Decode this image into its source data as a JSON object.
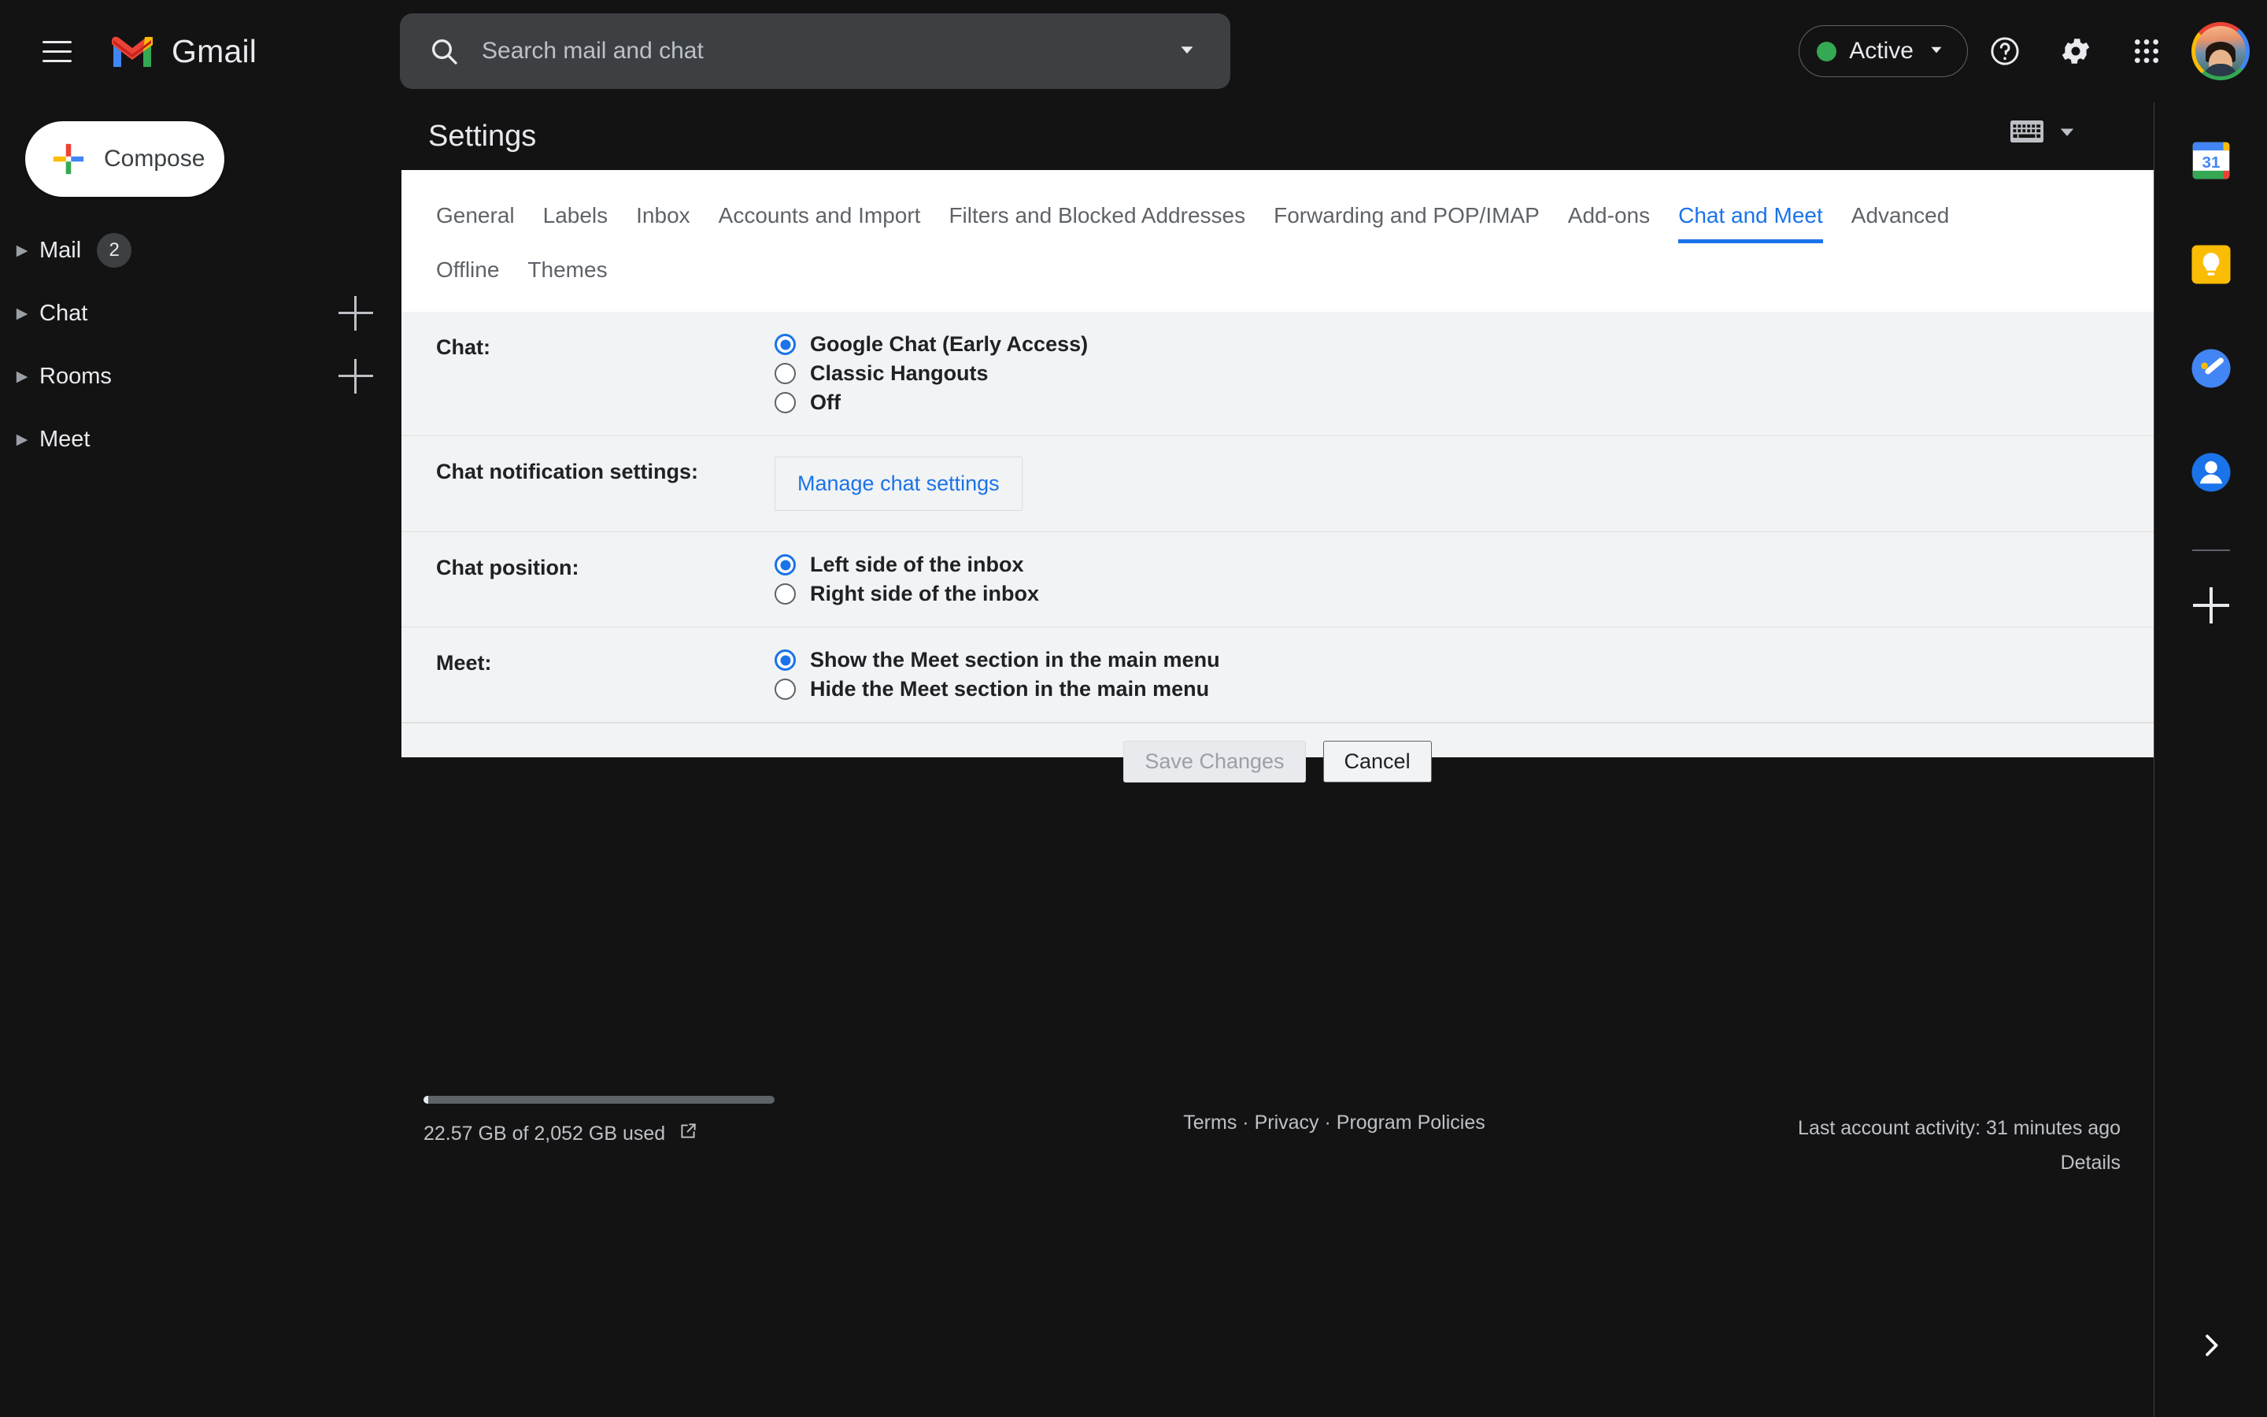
{
  "app": {
    "name": "Gmail"
  },
  "topbar": {
    "menu_label": "Main menu",
    "search_placeholder": "Search mail and chat",
    "search_value": "",
    "status_label": "Active",
    "status_color": "#34a853",
    "help_label": "Support",
    "settings_label": "Settings",
    "apps_label": "Google apps",
    "account_label": "Google Account"
  },
  "sidebar": {
    "compose_label": "Compose",
    "groups": [
      {
        "label": "Mail",
        "badge": "2",
        "has_add": false
      },
      {
        "label": "Chat",
        "badge": "",
        "has_add": true
      },
      {
        "label": "Rooms",
        "badge": "",
        "has_add": true
      },
      {
        "label": "Meet",
        "badge": "",
        "has_add": false
      }
    ]
  },
  "settings": {
    "title": "Settings",
    "tabs_row1": [
      {
        "label": "General",
        "active": false
      },
      {
        "label": "Labels",
        "active": false
      },
      {
        "label": "Inbox",
        "active": false
      },
      {
        "label": "Accounts and Import",
        "active": false
      },
      {
        "label": "Filters and Blocked Addresses",
        "active": false
      },
      {
        "label": "Forwarding and POP/IMAP",
        "active": false
      },
      {
        "label": "Add-ons",
        "active": false
      },
      {
        "label": "Chat and Meet",
        "active": true
      },
      {
        "label": "Advanced",
        "active": false
      }
    ],
    "tabs_row2": [
      {
        "label": "Offline",
        "active": false
      },
      {
        "label": "Themes",
        "active": false
      }
    ],
    "rows": {
      "chat": {
        "label": "Chat:",
        "options": [
          {
            "text": "Google Chat (Early Access)",
            "checked": true
          },
          {
            "text": "Classic Hangouts",
            "checked": false
          },
          {
            "text": "Off",
            "checked": false
          }
        ]
      },
      "chat_notifications": {
        "label": "Chat notification settings:",
        "button_label": "Manage chat settings"
      },
      "chat_position": {
        "label": "Chat position:",
        "options": [
          {
            "text": "Left side of the inbox",
            "checked": true
          },
          {
            "text": "Right side of the inbox",
            "checked": false
          }
        ]
      },
      "meet": {
        "label": "Meet:",
        "options": [
          {
            "text": "Show the Meet section in the main menu",
            "checked": true
          },
          {
            "text": "Hide the Meet section in the main menu",
            "checked": false
          }
        ]
      }
    },
    "save_label": "Save Changes",
    "cancel_label": "Cancel",
    "accent_color": "#1a73e8"
  },
  "footer": {
    "storage_text": "22.57 GB of 2,052 GB used",
    "storage_used_gb": 22.57,
    "storage_total_gb": 2052,
    "terms": "Terms",
    "sep1": "·",
    "privacy": "Privacy",
    "sep2": "·",
    "policies": "Program Policies",
    "activity": "Last account activity: 31 minutes ago",
    "details": "Details"
  },
  "rightrail": {
    "icons": [
      {
        "name": "google-calendar-icon",
        "label": "Calendar",
        "day": "31"
      },
      {
        "name": "google-keep-icon",
        "label": "Keep"
      },
      {
        "name": "google-tasks-icon",
        "label": "Tasks"
      },
      {
        "name": "google-contacts-icon",
        "label": "Contacts"
      }
    ],
    "add_label": "Get add-ons",
    "expand_label": "Show side panel"
  }
}
